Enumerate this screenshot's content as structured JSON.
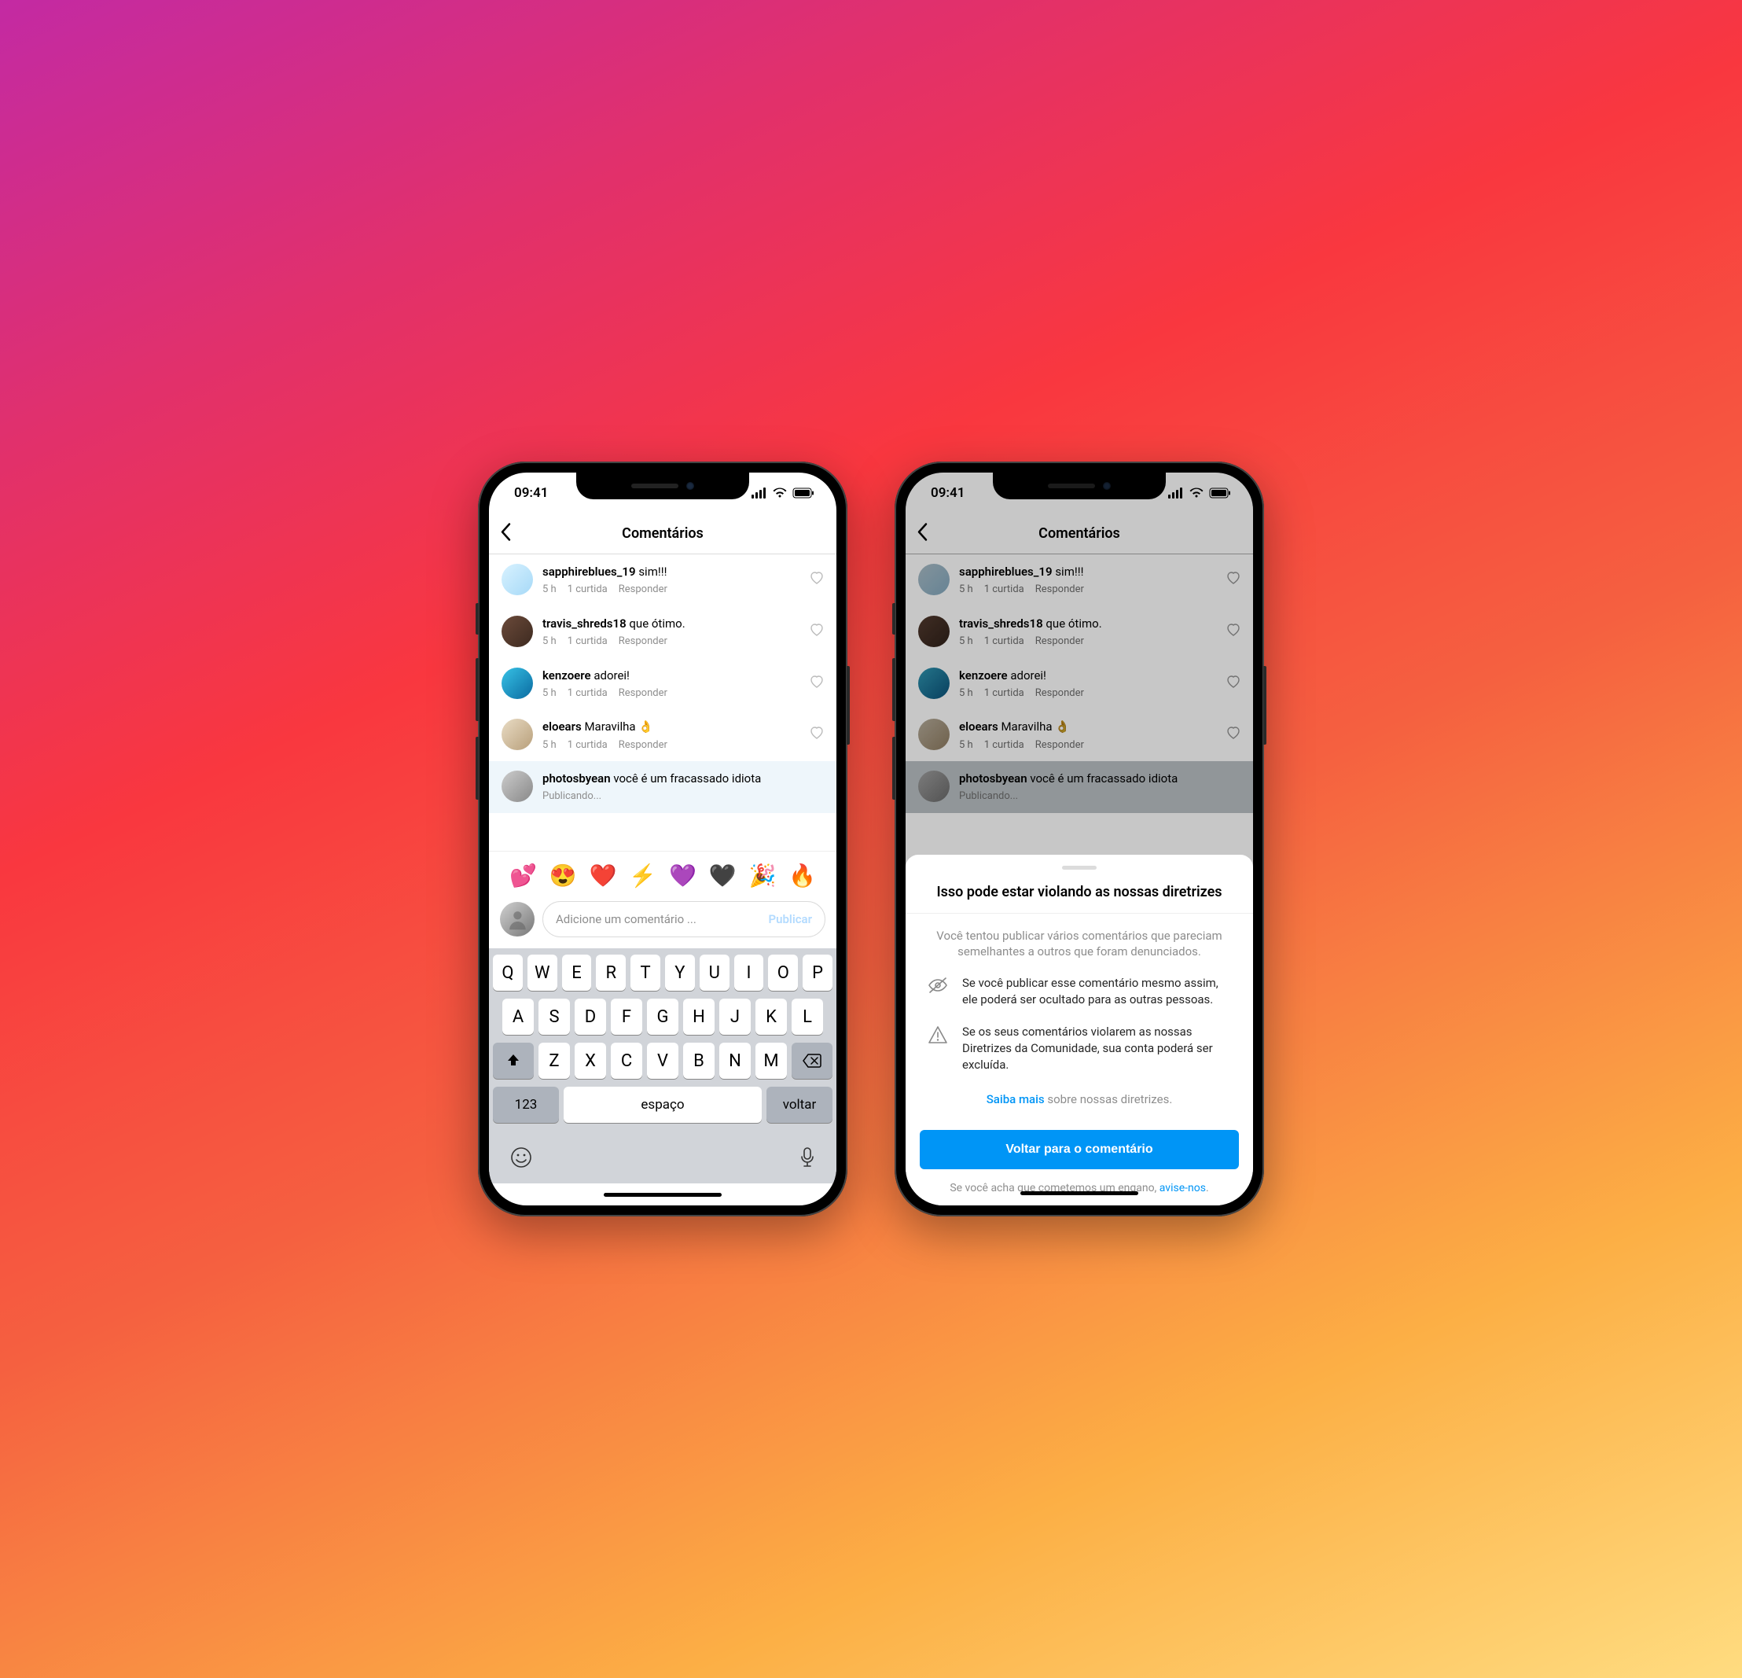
{
  "status": {
    "time": "09:41"
  },
  "header": {
    "title": "Comentários"
  },
  "comments": [
    {
      "user": "sapphireblues_19",
      "text": "sim!!!",
      "time": "5 h",
      "likes": "1 curtida",
      "reply": "Responder",
      "avatar": "av-1"
    },
    {
      "user": "travis_shreds18",
      "text": "que ótimo.",
      "time": "5 h",
      "likes": "1 curtida",
      "reply": "Responder",
      "avatar": "av-2"
    },
    {
      "user": "kenzoere",
      "text": "adorei!",
      "time": "5 h",
      "likes": "1 curtida",
      "reply": "Responder",
      "avatar": "av-3"
    },
    {
      "user": "eloears",
      "text": "Maravilha 👌",
      "time": "5 h",
      "likes": "1 curtida",
      "reply": "Responder",
      "avatar": "av-4"
    },
    {
      "user": "photosbyean",
      "text": "você é um fracassado idiota",
      "status": "Publicando...",
      "avatar": "av-5",
      "pending": true
    }
  ],
  "emojiBar": [
    "💕",
    "😍",
    "❤️",
    "⚡",
    "💜",
    "🖤",
    "🎉",
    "🔥"
  ],
  "compose": {
    "placeholder": "Adicione um comentário ...",
    "publish": "Publicar"
  },
  "keyboard": {
    "row1": [
      "Q",
      "W",
      "E",
      "R",
      "T",
      "Y",
      "U",
      "I",
      "O",
      "P"
    ],
    "row2": [
      "A",
      "S",
      "D",
      "F",
      "G",
      "H",
      "J",
      "K",
      "L"
    ],
    "row3": [
      "Z",
      "X",
      "C",
      "V",
      "B",
      "N",
      "M"
    ],
    "num": "123",
    "space": "espaço",
    "ret": "voltar"
  },
  "sheet": {
    "title": "Isso pode estar violando as nossas diretrizes",
    "sub": "Você tentou publicar vários comentários que pareciam semelhantes a outros que foram denunciados.",
    "item1": "Se você publicar esse comentário mesmo assim, ele poderá ser ocultado para as outras pessoas.",
    "item2": "Se os seus comentários violarem as nossas Diretrizes da Comunidade, sua conta poderá ser excluída.",
    "learnLink": "Saiba mais",
    "learnRest": " sobre nossas diretrizes.",
    "primary": "Voltar para o comentário",
    "mistakePre": "Se você acha que cometemos um engano, ",
    "mistakeLink": "avise-nos",
    "mistakePost": "."
  }
}
